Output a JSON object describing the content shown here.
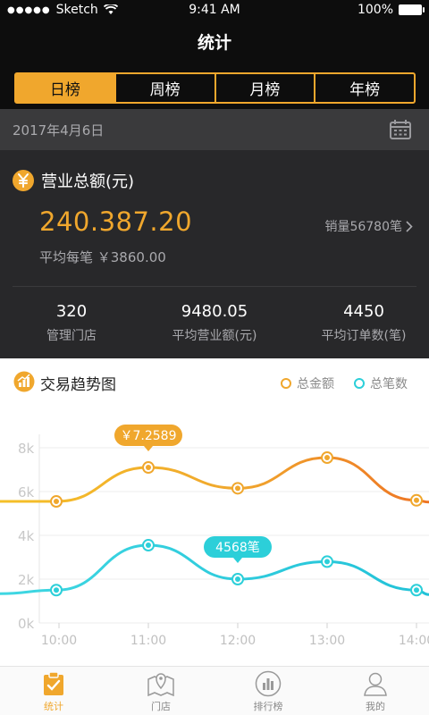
{
  "status_bar": {
    "signal": "●●●●●",
    "carrier": "Sketch",
    "time": "9:41 AM",
    "battery": "100%"
  },
  "nav": {
    "title": "统计"
  },
  "period_tabs": [
    {
      "label": "日榜",
      "active": true
    },
    {
      "label": "周榜",
      "active": false
    },
    {
      "label": "月榜",
      "active": false
    },
    {
      "label": "年榜",
      "active": false
    }
  ],
  "date": "2017年4月6日",
  "summary": {
    "title": "营业总额(元)",
    "amount": "240.387.20",
    "sales_count": "销量56780笔",
    "average": "平均每笔 ￥3860.00",
    "stats": [
      {
        "value": "320",
        "label": "管理门店"
      },
      {
        "value": "9480.05",
        "label": "平均营业额(元)"
      },
      {
        "value": "4450",
        "label": "平均订单数(笔)"
      }
    ]
  },
  "trend": {
    "title": "交易趋势图",
    "legend": [
      {
        "label": "总金额",
        "color": "#f0a72d"
      },
      {
        "label": "总笔数",
        "color": "#2ccfd9"
      }
    ]
  },
  "chart_data": {
    "type": "line",
    "x": [
      "10:00",
      "11:00",
      "12:00",
      "13:00",
      "14:00"
    ],
    "yticks": [
      "0k",
      "2k",
      "4k",
      "6k",
      "8k"
    ],
    "ylim": [
      0,
      8000
    ],
    "series": [
      {
        "name": "总金额",
        "color": "#f0a72d",
        "points": [
          [
            9.97,
            5550
          ],
          [
            11,
            7100
          ],
          [
            12,
            6150
          ],
          [
            13,
            7550
          ],
          [
            14,
            5600
          ]
        ],
        "callout": "￥7.2589",
        "callout_index": 1
      },
      {
        "name": "总笔数",
        "color": "#2ccfd9",
        "points": [
          [
            9.97,
            1500
          ],
          [
            11,
            3550
          ],
          [
            12,
            2000
          ],
          [
            13,
            2800
          ],
          [
            14,
            1500
          ]
        ],
        "callout": "4568笔",
        "callout_index": 2
      }
    ]
  },
  "tabbar": [
    {
      "label": "统计",
      "icon": "clipboard-check-icon",
      "active": true
    },
    {
      "label": "门店",
      "icon": "map-pin-icon",
      "active": false
    },
    {
      "label": "排行榜",
      "icon": "bar-chart-icon",
      "active": false
    },
    {
      "label": "我的",
      "icon": "user-icon",
      "active": false
    }
  ]
}
